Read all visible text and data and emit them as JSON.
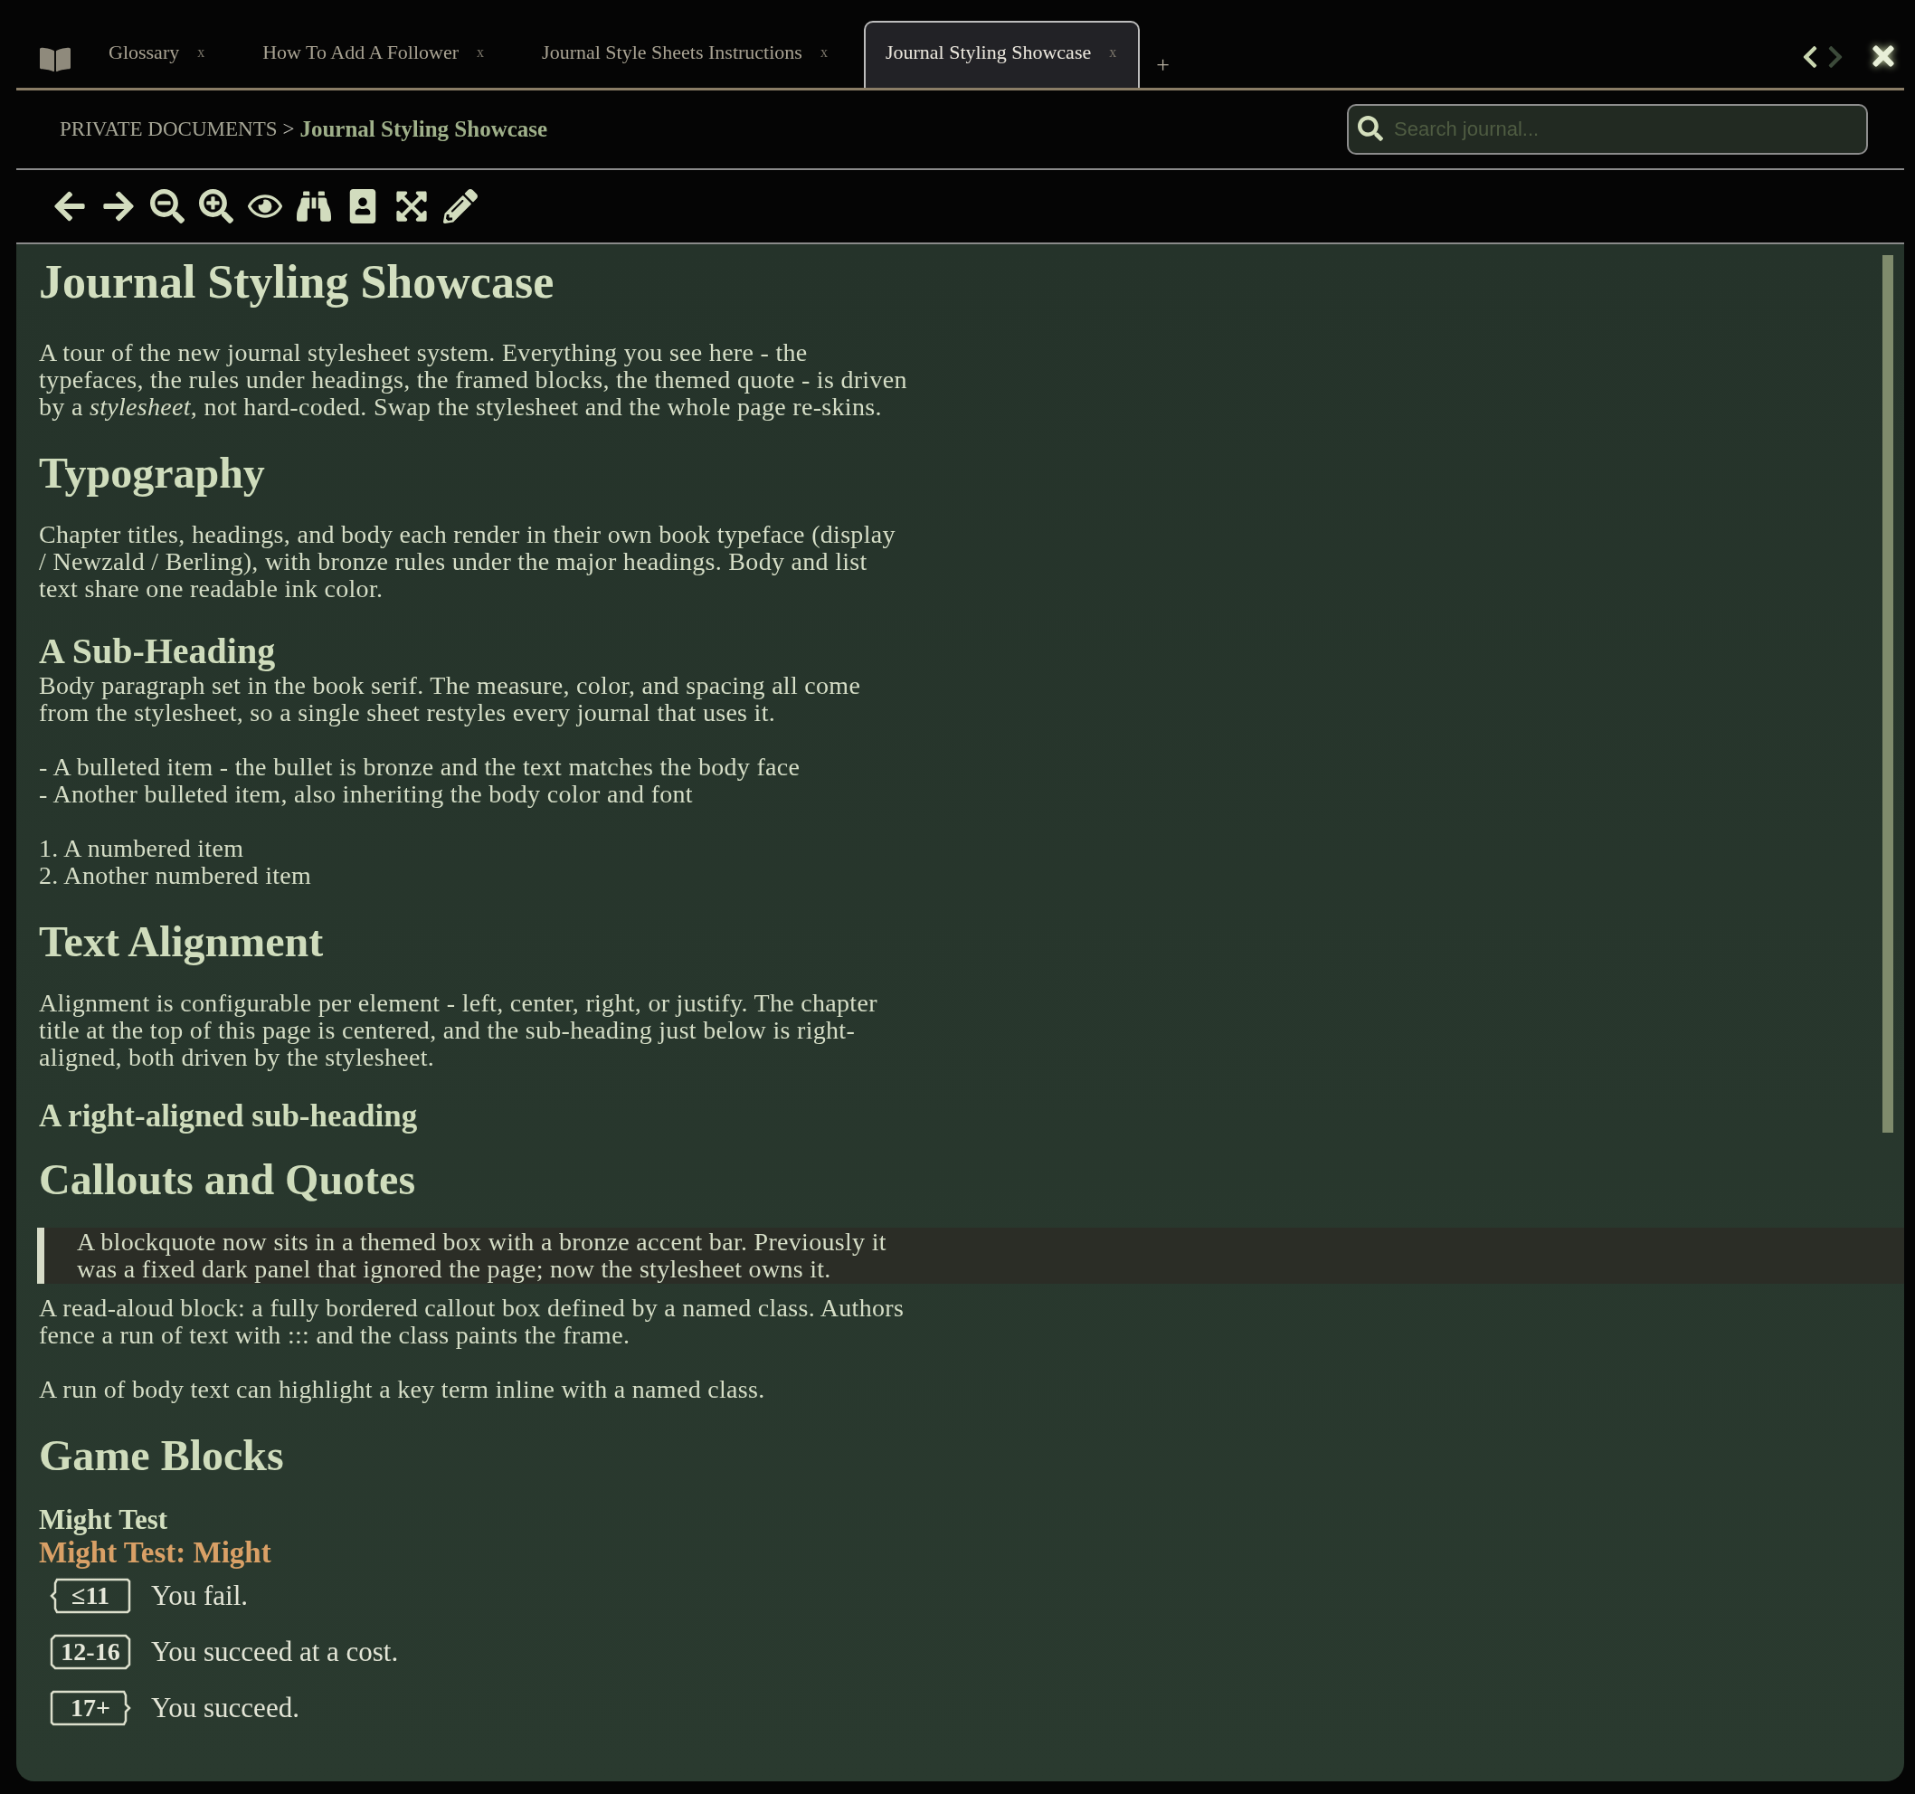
{
  "tabs": [
    {
      "label": "Glossary",
      "close": "x",
      "selected": false
    },
    {
      "label": "How To Add A Follower",
      "close": "x",
      "selected": false
    },
    {
      "label": "Journal Style Sheets Instructions",
      "close": "x",
      "selected": false
    },
    {
      "label": "Journal Styling Showcase",
      "close": "x",
      "selected": true
    }
  ],
  "add_tab": "+",
  "breadcrumb": {
    "path": "PRIVATE DOCUMENTS",
    "separator": ">",
    "current": "Journal Styling Showcase"
  },
  "search": {
    "placeholder": "Search journal..."
  },
  "content": [
    {
      "kind": "title",
      "text": "Journal Styling Showcase"
    },
    {
      "kind": "paragraph",
      "text": "A tour of the new journal stylesheet system. Everything you see here - the typefaces, the rules under headings, the framed blocks, the themed quote - is driven by a *stylesheet*, not hard-coded. Swap the stylesheet and the whole page re-skins."
    },
    {
      "kind": "heading",
      "text": "Typography"
    },
    {
      "kind": "paragraph",
      "text": "Chapter titles, headings, and body each render in their own book typeface (display / Newzald / Berling), with bronze rules under the major headings. Body and list text share one readable ink color."
    },
    {
      "kind": "subheading",
      "text": "A Sub-Heading"
    },
    {
      "kind": "paragraph",
      "text": "Body paragraph set in the book serif. The measure, color, and spacing all come from the stylesheet, so a single sheet restyles every journal that uses it."
    },
    {
      "kind": "list",
      "items": [
        "- A bulleted item - the bullet is bronze and the text matches the body face",
        "- Another bulleted item, also inheriting the body color and font"
      ]
    },
    {
      "kind": "list",
      "items": [
        "1. A numbered item",
        "2. Another numbered item"
      ]
    },
    {
      "kind": "heading",
      "text": "Text Alignment"
    },
    {
      "kind": "paragraph",
      "text": "Alignment is configurable per element - left, center, right, or justify. The chapter title at the top of this page is centered, and the sub-heading just below is right-aligned, both driven by the stylesheet."
    },
    {
      "kind": "minor_heading",
      "text": "A right-aligned sub-heading"
    },
    {
      "kind": "heading",
      "text": "Callouts and Quotes"
    },
    {
      "kind": "blockquote",
      "text": "A blockquote now sits in a themed box with a bronze accent bar. Previously it was a fixed dark panel that ignored the page; now the stylesheet owns it."
    },
    {
      "kind": "paragraph",
      "text": "A read-aloud block: a fully bordered callout box defined by a named class. Authors fence a run of text with ::: and the class paints the frame."
    },
    {
      "kind": "paragraph",
      "text": "A run of body text can highlight a key term inline with a named class."
    },
    {
      "kind": "heading",
      "text": "Game Blocks"
    },
    {
      "kind": "test_name",
      "text": "Might Test"
    },
    {
      "kind": "test_label",
      "text": "Might Test: Might"
    },
    {
      "kind": "outcomes",
      "items": [
        {
          "kind": "low",
          "range": "≤11",
          "result": "You fail."
        },
        {
          "kind": "mid",
          "range": "12-16",
          "result": "You succeed at a cost."
        },
        {
          "kind": "high",
          "range": "17+",
          "result": "You succeed."
        }
      ]
    }
  ]
}
